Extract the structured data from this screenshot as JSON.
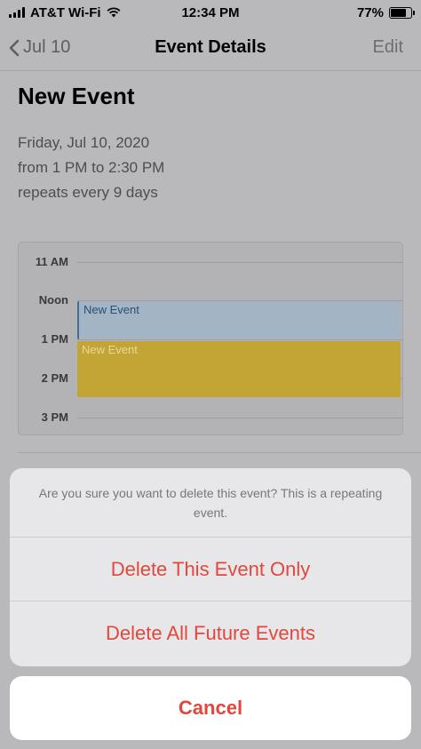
{
  "status_bar": {
    "carrier": "AT&T Wi-Fi",
    "time": "12:34 PM",
    "battery": "77%",
    "battery_level": 0.77
  },
  "nav": {
    "back_label": "Jul 10",
    "title": "Event Details",
    "edit_label": "Edit"
  },
  "event": {
    "title": "New Event",
    "date": "Friday, Jul 10, 2020",
    "time_range": "from 1 PM to 2:30 PM",
    "repeat": "repeats every 9 days"
  },
  "day_view": {
    "hours": [
      "11 AM",
      "Noon",
      "1 PM",
      "2 PM",
      "3 PM"
    ],
    "events": [
      {
        "title": "New Event"
      },
      {
        "title": "New Event"
      }
    ]
  },
  "action_sheet": {
    "message": "Are you sure you want to delete this event? This is a repeating event.",
    "delete_this": "Delete This Event Only",
    "delete_future": "Delete All Future Events",
    "cancel": "Cancel"
  },
  "colors": {
    "destructive": "#e1473c",
    "event_blue": "#a3b4c4",
    "event_gold": "#c3a536"
  }
}
